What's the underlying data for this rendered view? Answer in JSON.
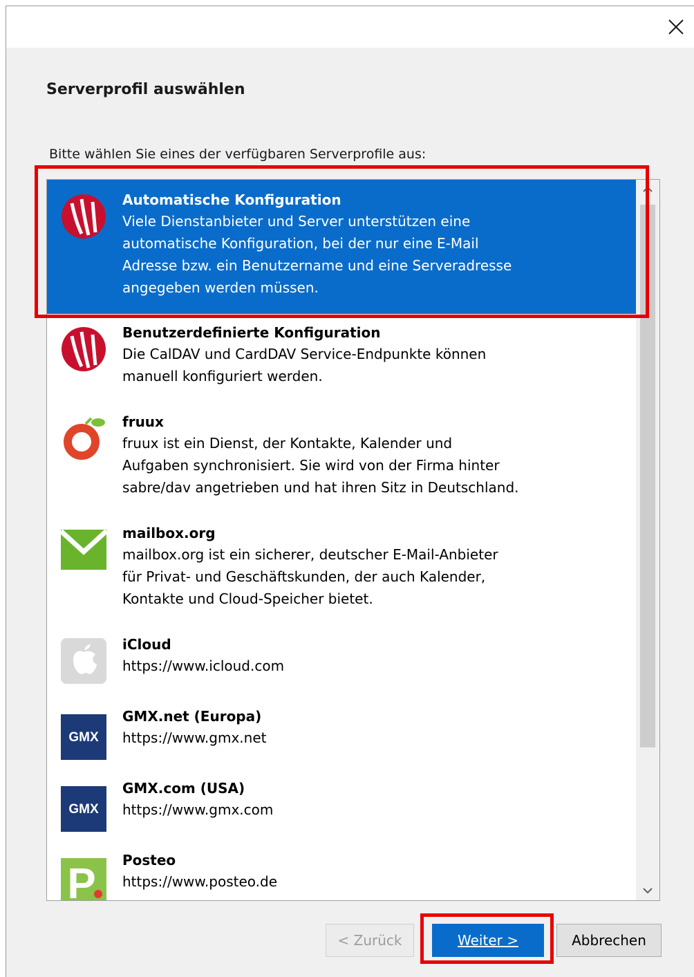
{
  "window": {
    "close_icon": "close-icon"
  },
  "header": {
    "title": "Serverprofil auswählen"
  },
  "instruction": "Bitte wählen Sie eines der verfügbaren Serverprofile aus:",
  "profiles": [
    {
      "name": "Automatische Konfiguration",
      "desc": "Viele Dienstanbieter und Server unterstützen eine\nautomatische Konfiguration, bei der nur eine E-Mail\nAdresse bzw. ein Benutzername und eine Serveradresse\nangegeben werden müssen.",
      "icon": "davx-logo-icon",
      "selected": true
    },
    {
      "name": "Benutzerdefinierte Konfiguration",
      "desc": "Die CalDAV und CardDAV Service-Endpunkte können\nmanuell konfiguriert werden.",
      "icon": "davx-logo-icon"
    },
    {
      "name": "fruux",
      "desc": "fruux ist ein Dienst, der Kontakte, Kalender und\nAufgaben synchronisiert. Sie wird von der Firma hinter\nsabre/dav angetrieben und hat ihren Sitz in Deutschland.",
      "icon": "fruux-logo-icon"
    },
    {
      "name": "mailbox.org",
      "desc": "mailbox.org ist ein sicherer, deutscher E-Mail-Anbieter\nfür Privat- und Geschäftskunden, der auch Kalender,\nKontakte und Cloud-Speicher bietet.",
      "icon": "mailbox-envelope-icon"
    },
    {
      "name": "iCloud",
      "desc": "https://www.icloud.com",
      "icon": "apple-logo-icon"
    },
    {
      "name": "GMX.net (Europa)",
      "desc": "https://www.gmx.net",
      "icon": "gmx-logo-icon"
    },
    {
      "name": "GMX.com (USA)",
      "desc": "https://www.gmx.com",
      "icon": "gmx-logo-icon"
    },
    {
      "name": "Posteo",
      "desc": "https://www.posteo.de",
      "icon": "posteo-logo-icon"
    }
  ],
  "logo_text": {
    "gmx": "GMX",
    "posteo": "P"
  },
  "buttons": {
    "back": "< Zurück",
    "next": "Weiter >",
    "cancel": "Abbrechen"
  },
  "colors": {
    "selection": "#0a6cca",
    "highlight": "#e60000"
  }
}
